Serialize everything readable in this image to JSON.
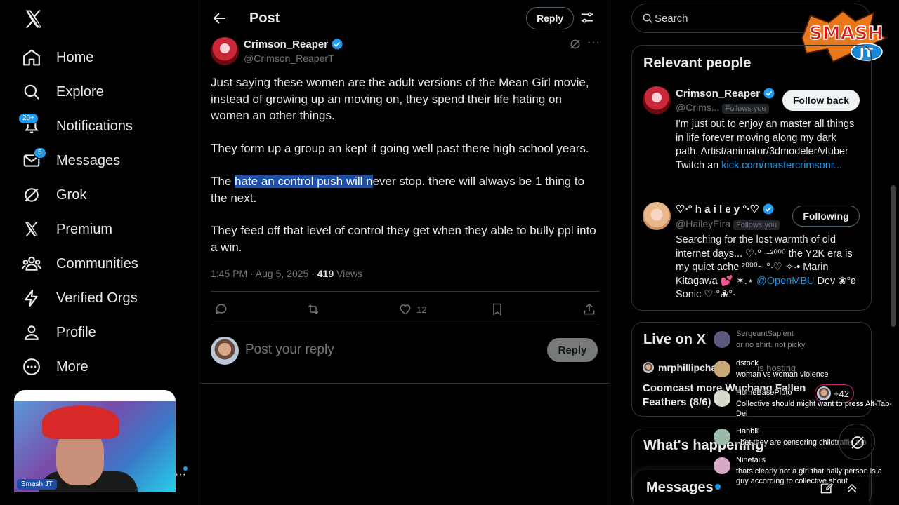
{
  "nav": {
    "items": [
      {
        "label": "Home",
        "icon": "home-icon"
      },
      {
        "label": "Explore",
        "icon": "search-icon"
      },
      {
        "label": "Notifications",
        "icon": "bell-icon",
        "badge": "20+"
      },
      {
        "label": "Messages",
        "icon": "envelope-icon",
        "badge": "5"
      },
      {
        "label": "Grok",
        "icon": "grok-icon"
      },
      {
        "label": "Premium",
        "icon": "x-logo-icon"
      },
      {
        "label": "Communities",
        "icon": "people-icon"
      },
      {
        "label": "Verified Orgs",
        "icon": "lightning-icon"
      },
      {
        "label": "Profile",
        "icon": "person-icon"
      },
      {
        "label": "More",
        "icon": "more-circle-icon"
      }
    ]
  },
  "webcam": {
    "tag": "Smash JT"
  },
  "header": {
    "title": "Post",
    "reply_label": "Reply"
  },
  "post": {
    "author_name": "Crimson_Reaper",
    "author_handle": "@Crimson_ReaperT",
    "p1": "Just saying these women are the adult versions of the Mean Girl movie, instead of growing up an moving on, they spend their life hating on women an other things.",
    "p2": "They form up a group an kept it going well past there high school years.",
    "p3_pre": "The ",
    "p3_hl": "hate an control push will n",
    "p3_post": "ever stop. there will always be 1 thing to the next.",
    "p4": "They feed off that level of control they get when they able to bully ppl into a win.",
    "time": "1:45 PM · Aug 5, 2025 · ",
    "views_count": "419",
    "views_label": " Views",
    "likes": "12"
  },
  "reply_box": {
    "placeholder": "Post your reply",
    "button": "Reply"
  },
  "search": {
    "placeholder": "Search"
  },
  "overlay_logo": {
    "line1": "SMASH",
    "line2": "JT"
  },
  "relevant": {
    "title": "Relevant people",
    "people": [
      {
        "name": "Crimson_Reaper",
        "handle": "@Crims...",
        "follows_you": "Follows you",
        "button": "Follow back",
        "bio": "I'm just out to enjoy an master all things in life forever moving along my dark path. Artist/animator/3dmodeler/vtuber Twitch an ",
        "bio_link": "kick.com/mastercrimsonr..."
      },
      {
        "name": "♡∙° h a i l e y °∙♡",
        "handle": "@HaileyEira",
        "follows_you": "Follows you",
        "button": "Following",
        "bio": "Searching for the lost warmth of old internet days... ♡∙° ~²⁰⁰⁰ the Y2K era is my quiet ache ²⁰⁰⁰~ °∙♡ ✧∙• Marin Kitagawa 💕 ✶.⋆ ",
        "bio_link": "@OpenMBU",
        "bio_post": " Dev ❀°ʚ Sonic ♡ °❀°∙"
      }
    ]
  },
  "live": {
    "title": "Live on X",
    "host": "mrphillipcha",
    "hosting": "is hosting",
    "space_title": "Coomcast more Wuchang Fallen Feathers (8/6)",
    "count": "+42"
  },
  "happening": {
    "title": "What's happening"
  },
  "messages_bar": {
    "label": "Messages"
  },
  "chat": [
    {
      "user": "SergeantSapient",
      "text": "or no shirt. not picky",
      "faded": true
    },
    {
      "user": "dstock",
      "text": "woman vs woman violence"
    },
    {
      "user": "HomeBasePluto",
      "text": "Collective should might want to press Alt-Tab-Del"
    },
    {
      "user": "Hanbill",
      "text": "I bet they are censoring childtraffic too"
    },
    {
      "user": "Ninetails",
      "text": "thats clearly not a girl that haily person is a guy according to collective shout"
    }
  ],
  "colors": {
    "accent": "#1d9bf0",
    "highlight": "#1d4fa8",
    "border": "#2f3336",
    "muted": "#71767b"
  }
}
